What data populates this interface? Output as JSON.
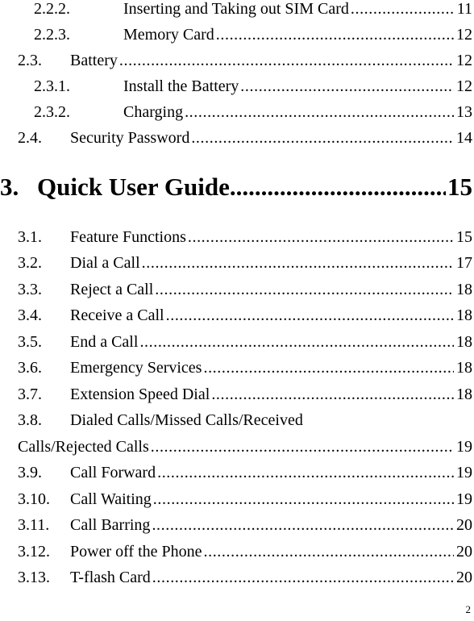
{
  "toc": {
    "before": [
      {
        "level": 3,
        "number": "2.2.2.",
        "title": "Inserting and Taking out SIM Card",
        "page": "11"
      },
      {
        "level": 3,
        "number": "2.2.3.",
        "title": "Memory Card",
        "page": "12"
      },
      {
        "level": 2,
        "number": "2.3.",
        "title": "Battery",
        "page": "12"
      },
      {
        "level": 3,
        "number": "2.3.1.",
        "title": "Install the Battery",
        "page": "12"
      },
      {
        "level": 3,
        "number": "2.3.2.",
        "title": "Charging",
        "page": "13"
      },
      {
        "level": 2,
        "number": "2.4.",
        "title": "Security Password",
        "page": "14"
      }
    ],
    "chapter": {
      "number": "3.",
      "title": "Quick User Guide",
      "page": "15"
    },
    "after": [
      {
        "level": 2,
        "number": "3.1.",
        "title": "Feature Functions",
        "page": "15"
      },
      {
        "level": 2,
        "number": "3.2.",
        "title": "Dial a Call",
        "page": "17"
      },
      {
        "level": 2,
        "number": "3.3.",
        "title": "Reject a Call",
        "page": "18"
      },
      {
        "level": 2,
        "number": "3.4.",
        "title": "Receive a Call",
        "page": "18"
      },
      {
        "level": 2,
        "number": "3.5.",
        "title": "End a Call",
        "page": "18"
      },
      {
        "level": 2,
        "number": "3.6.",
        "title": "Emergency Services",
        "page": "18"
      },
      {
        "level": 2,
        "number": "3.7.",
        "title": "Extension Speed Dial",
        "page": "18"
      },
      {
        "level": 2,
        "number": "3.8.",
        "title": "Dialed Calls/Missed Calls/Received",
        "continuation": "Calls/Rejected Calls",
        "page": "19"
      },
      {
        "level": 2,
        "number": "3.9.",
        "title": "Call Forward",
        "page": "19"
      },
      {
        "level": 2,
        "number": "3.10.",
        "title": "Call Waiting",
        "page": "19"
      },
      {
        "level": 2,
        "number": "3.11.",
        "title": "Call Barring",
        "page": "20"
      },
      {
        "level": 2,
        "number": "3.12.",
        "title": "Power off the Phone",
        "page": "20"
      },
      {
        "level": 2,
        "number": "3.13.",
        "title": "T-flash Card",
        "page": "20"
      }
    ]
  },
  "footer": {
    "page_number": "2"
  }
}
